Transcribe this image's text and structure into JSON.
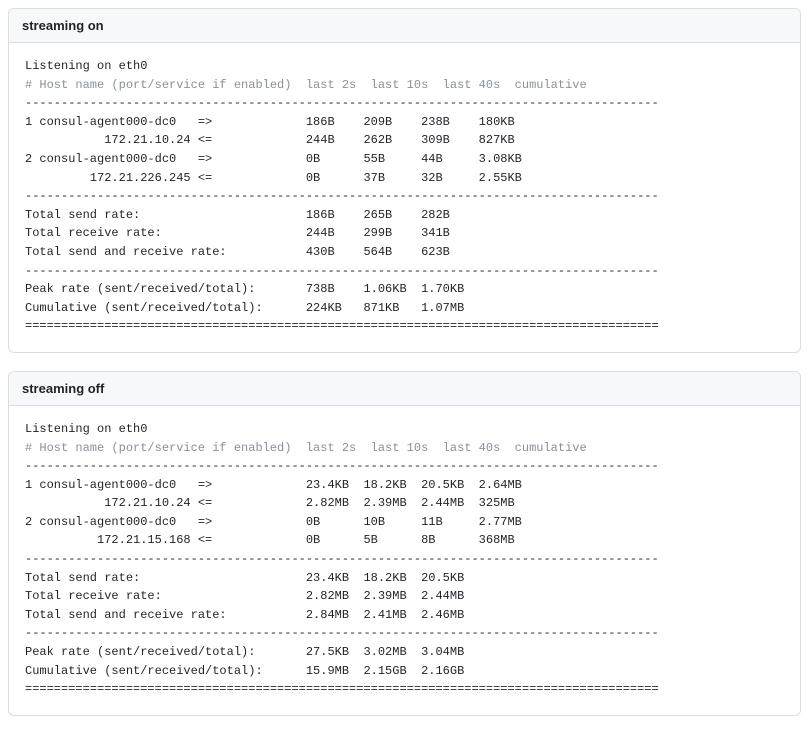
{
  "panels": [
    {
      "title": "streaming on",
      "listening": "Listening on eth0",
      "header_comment": "# Host name (port/service if enabled)  last 2s  last 10s  last 40s  cumulative",
      "divider": "----------------------------------------------------------------------------------------",
      "doubleline": "========================================================================================",
      "rows": [
        {
          "idx": "1",
          "host": "consul-agent000-dc0",
          "dir": "=>",
          "c1": "186B",
          "c2": "209B",
          "c3": "238B",
          "c4": "180KB"
        },
        {
          "idx": " ",
          "host": "172.21.10.24",
          "dir": "<=",
          "c1": "244B",
          "c2": "262B",
          "c3": "309B",
          "c4": "827KB"
        },
        {
          "idx": "2",
          "host": "consul-agent000-dc0",
          "dir": "=>",
          "c1": "0B",
          "c2": "55B",
          "c3": "44B",
          "c4": "3.08KB"
        },
        {
          "idx": " ",
          "host": "172.21.226.245",
          "dir": "<=",
          "c1": "0B",
          "c2": "37B",
          "c3": "32B",
          "c4": "2.55KB"
        }
      ],
      "totals": [
        {
          "label": "Total send rate:",
          "c1": "186B",
          "c2": "265B",
          "c3": "282B"
        },
        {
          "label": "Total receive rate:",
          "c1": "244B",
          "c2": "299B",
          "c3": "341B"
        },
        {
          "label": "Total send and receive rate:",
          "c1": "430B",
          "c2": "564B",
          "c3": "623B"
        }
      ],
      "footer": [
        {
          "label": "Peak rate (sent/received/total):",
          "c1": "738B",
          "c2": "1.06KB",
          "c3": "1.70KB"
        },
        {
          "label": "Cumulative (sent/received/total):",
          "c1": "224KB",
          "c2": "871KB",
          "c3": "1.07MB"
        }
      ]
    },
    {
      "title": "streaming off",
      "listening": "Listening on eth0",
      "header_comment": "# Host name (port/service if enabled)  last 2s  last 10s  last 40s  cumulative",
      "divider": "----------------------------------------------------------------------------------------",
      "doubleline": "========================================================================================",
      "rows": [
        {
          "idx": "1",
          "host": "consul-agent000-dc0",
          "dir": "=>",
          "c1": "23.4KB",
          "c2": "18.2KB",
          "c3": "20.5KB",
          "c4": "2.64MB"
        },
        {
          "idx": " ",
          "host": "172.21.10.24",
          "dir": "<=",
          "c1": "2.82MB",
          "c2": "2.39MB",
          "c3": "2.44MB",
          "c4": "325MB"
        },
        {
          "idx": "2",
          "host": "consul-agent000-dc0",
          "dir": "=>",
          "c1": "0B",
          "c2": "10B",
          "c3": "11B",
          "c4": "2.77MB"
        },
        {
          "idx": " ",
          "host": "172.21.15.168",
          "dir": "<=",
          "c1": "0B",
          "c2": "5B",
          "c3": "8B",
          "c4": "368MB"
        }
      ],
      "totals": [
        {
          "label": "Total send rate:",
          "c1": "23.4KB",
          "c2": "18.2KB",
          "c3": "20.5KB"
        },
        {
          "label": "Total receive rate:",
          "c1": "2.82MB",
          "c2": "2.39MB",
          "c3": "2.44MB"
        },
        {
          "label": "Total send and receive rate:",
          "c1": "2.84MB",
          "c2": "2.41MB",
          "c3": "2.46MB"
        }
      ],
      "footer": [
        {
          "label": "Peak rate (sent/received/total):",
          "c1": "27.5KB",
          "c2": "3.02MB",
          "c3": "3.04MB"
        },
        {
          "label": "Cumulative (sent/received/total):",
          "c1": "15.9MB",
          "c2": "2.15GB",
          "c3": "2.16GB"
        }
      ]
    }
  ]
}
